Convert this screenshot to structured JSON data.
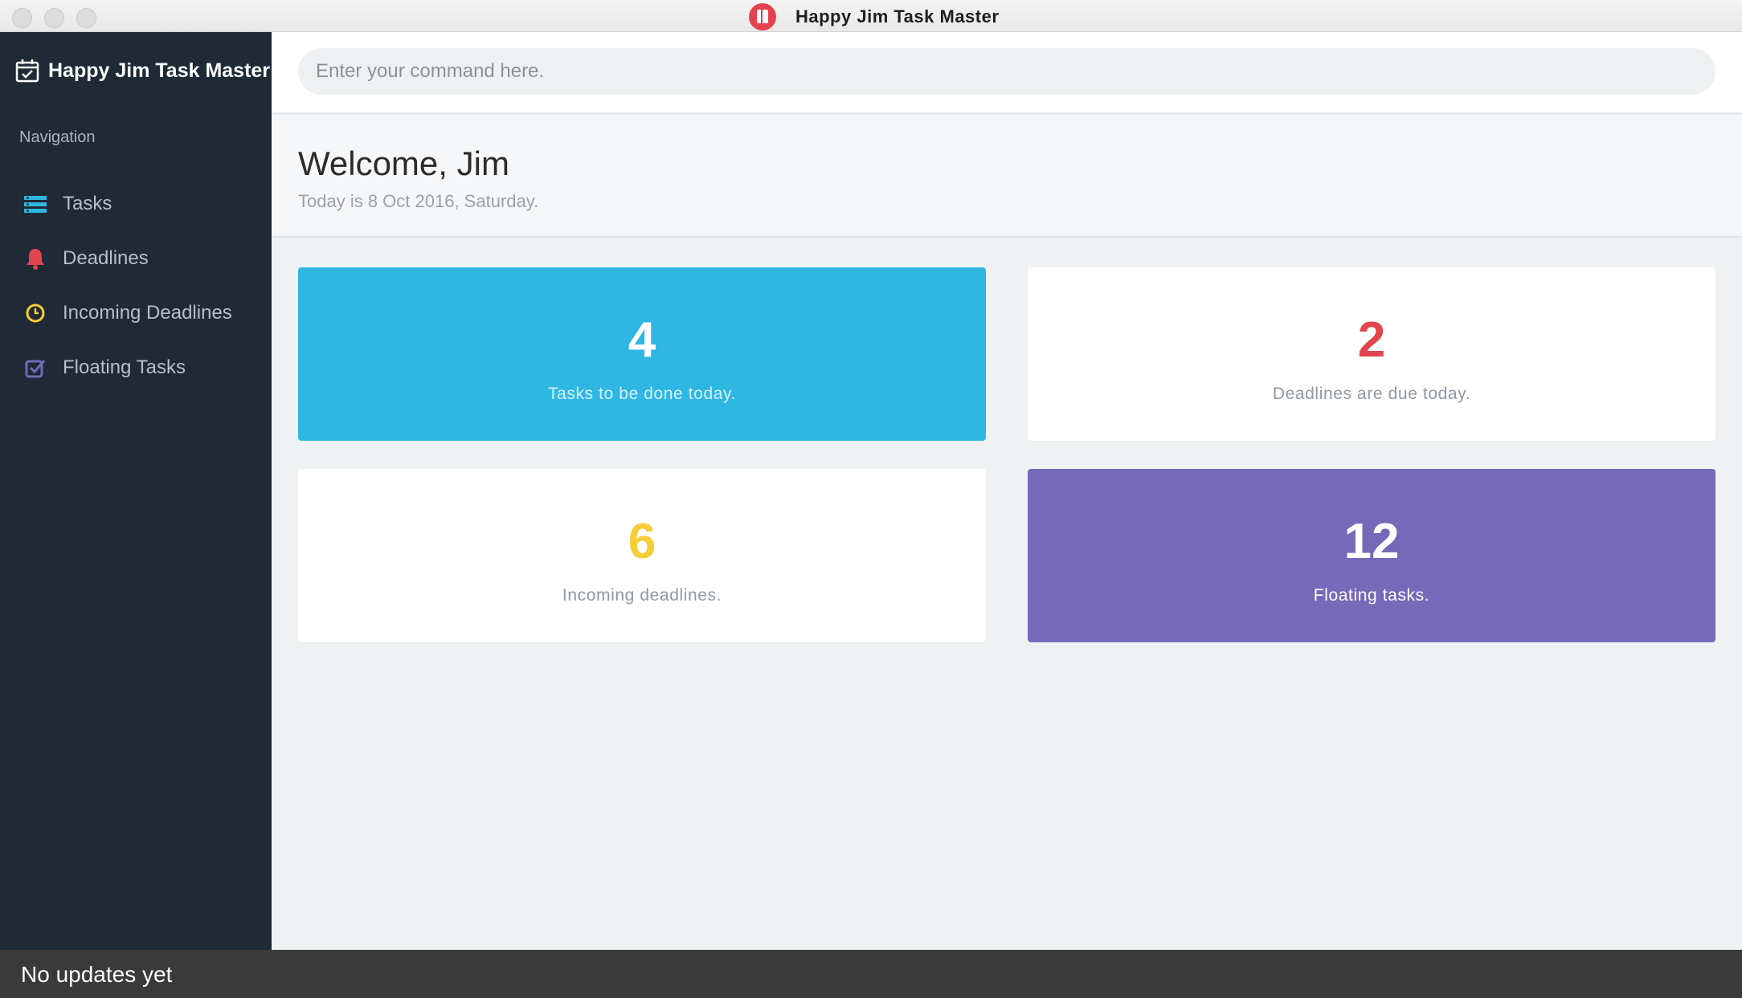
{
  "window": {
    "title": "Happy Jim Task Master"
  },
  "sidebar": {
    "brand": "Happy Jim Task Master",
    "nav_heading": "Navigation",
    "items": [
      {
        "label": "Tasks",
        "icon": "tasks-list-icon",
        "color": "#2fb7e4"
      },
      {
        "label": "Deadlines",
        "icon": "bell-icon",
        "color": "#e2454e"
      },
      {
        "label": "Incoming Deadlines",
        "icon": "clock-icon",
        "color": "#f5cd35"
      },
      {
        "label": "Floating Tasks",
        "icon": "checkbox-icon",
        "color": "#7669b9"
      }
    ]
  },
  "command": {
    "placeholder": "Enter your command here."
  },
  "welcome": {
    "title": "Welcome, Jim",
    "subtitle": "Today is 8 Oct 2016, Saturday."
  },
  "cards": [
    {
      "value": "4",
      "text": "Tasks to be done today.",
      "color": "#2fb7e4"
    },
    {
      "value": "2",
      "text": "Deadlines are due today.",
      "color": "#e2454e"
    },
    {
      "value": "6",
      "text": "Incoming deadlines.",
      "color": "#f5cd35"
    },
    {
      "value": "12",
      "text": "Floating tasks.",
      "color": "#7669b9"
    }
  ],
  "status": {
    "text": "No updates yet"
  }
}
